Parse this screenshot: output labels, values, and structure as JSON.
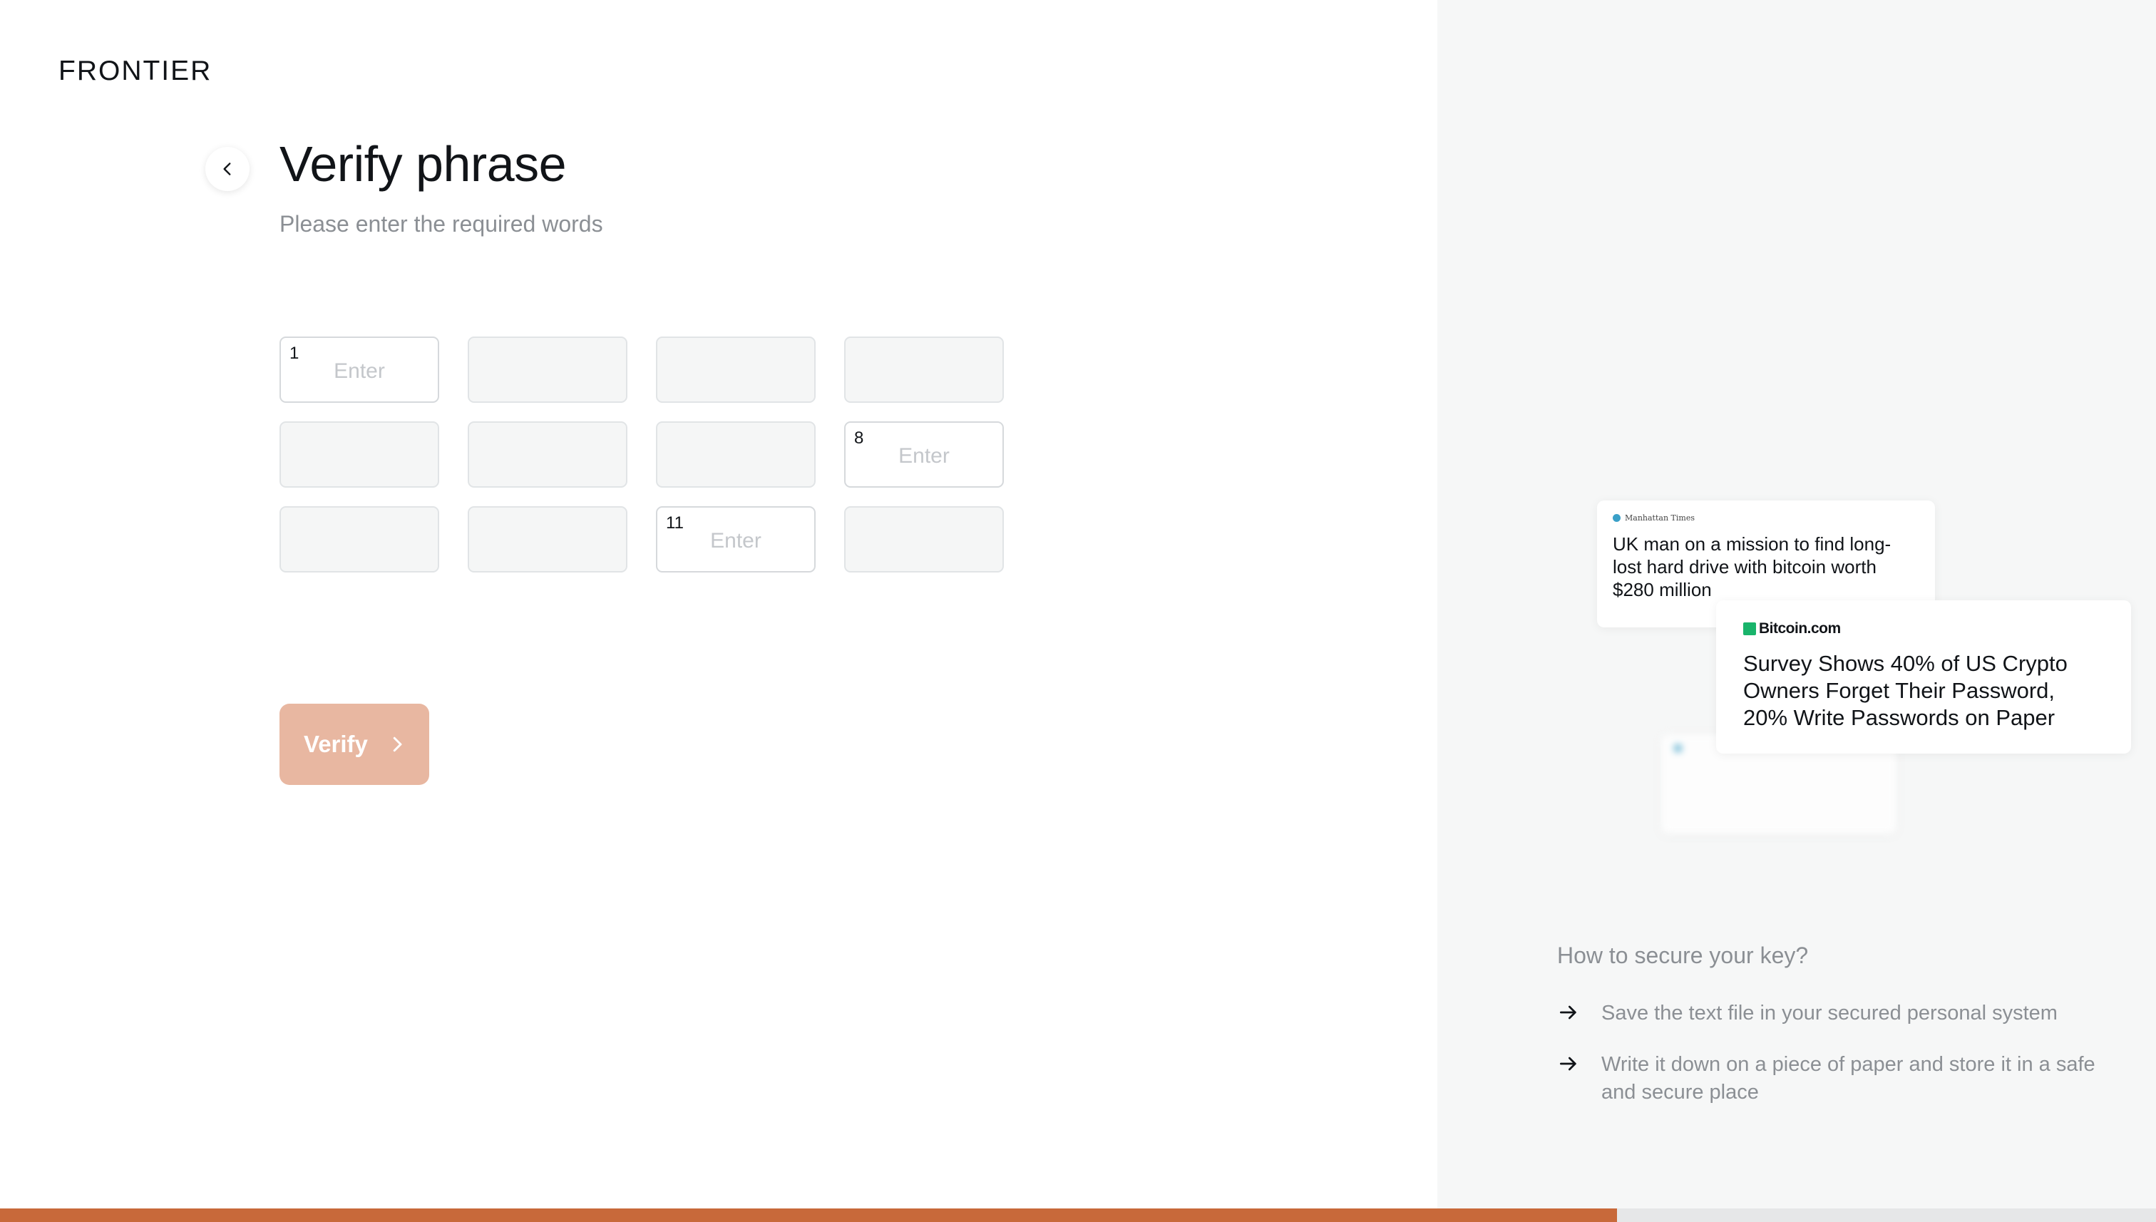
{
  "app": {
    "logo": "FRONTIER"
  },
  "header": {
    "title": "Verify phrase",
    "subtitle": "Please enter the required words"
  },
  "phrase_grid": {
    "placeholder": "Enter",
    "cells": [
      {
        "index": 1,
        "label": "1",
        "editable": true
      },
      {
        "index": 2,
        "label": "",
        "editable": false
      },
      {
        "index": 3,
        "label": "",
        "editable": false
      },
      {
        "index": 4,
        "label": "",
        "editable": false
      },
      {
        "index": 5,
        "label": "",
        "editable": false
      },
      {
        "index": 6,
        "label": "",
        "editable": false
      },
      {
        "index": 7,
        "label": "",
        "editable": false
      },
      {
        "index": 8,
        "label": "8",
        "editable": true
      },
      {
        "index": 9,
        "label": "",
        "editable": false
      },
      {
        "index": 10,
        "label": "",
        "editable": false
      },
      {
        "index": 11,
        "label": "11",
        "editable": true
      },
      {
        "index": 12,
        "label": "",
        "editable": false
      }
    ]
  },
  "actions": {
    "verify_label": "Verify"
  },
  "progress": {
    "fraction": 0.75,
    "color": "#c8693a"
  },
  "news": {
    "card1": {
      "source": "Manhattan Times",
      "headline": "UK man on a mission to find long-lost hard drive with bitcoin worth $280 million"
    },
    "card2": {
      "source": "Bitcoin.com",
      "headline": "Survey Shows 40% of US Crypto Owners Forget Their Password, 20% Write Passwords on Paper"
    }
  },
  "secure": {
    "title": "How to secure your key?",
    "tips": [
      "Save the text file in your secured personal system",
      "Write it down on a piece of paper and store it in a safe and secure place"
    ]
  },
  "colors": {
    "accent": "#c8693a",
    "verify_button_disabled": "#e8b7a1",
    "side_panel_bg": "#f6f7f7"
  }
}
